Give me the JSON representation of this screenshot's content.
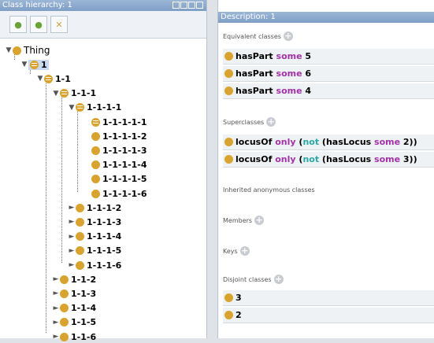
{
  "left": {
    "title": "Class hierarchy: 1",
    "tree": [
      {
        "label": "Thing",
        "level": 0,
        "toggle": "▼"
      },
      {
        "label": "1",
        "level": 1,
        "toggle": "▼",
        "selected": true,
        "eq": true
      },
      {
        "label": "1-1",
        "level": 2,
        "toggle": "▼",
        "eq": true
      },
      {
        "label": "1-1-1",
        "level": 3,
        "toggle": "▼",
        "eq": true
      },
      {
        "label": "1-1-1-1",
        "level": 4,
        "toggle": "▼",
        "eq": true
      },
      {
        "label": "1-1-1-1-1",
        "level": 5,
        "toggle": "",
        "eq": true
      },
      {
        "label": "1-1-1-1-2",
        "level": 5,
        "toggle": ""
      },
      {
        "label": "1-1-1-1-3",
        "level": 5,
        "toggle": ""
      },
      {
        "label": "1-1-1-1-4",
        "level": 5,
        "toggle": ""
      },
      {
        "label": "1-1-1-1-5",
        "level": 5,
        "toggle": ""
      },
      {
        "label": "1-1-1-1-6",
        "level": 5,
        "toggle": ""
      },
      {
        "label": "1-1-1-2",
        "level": 4,
        "toggle": "►"
      },
      {
        "label": "1-1-1-3",
        "level": 4,
        "toggle": "►"
      },
      {
        "label": "1-1-1-4",
        "level": 4,
        "toggle": "►"
      },
      {
        "label": "1-1-1-5",
        "level": 4,
        "toggle": "►"
      },
      {
        "label": "1-1-1-6",
        "level": 4,
        "toggle": "►"
      },
      {
        "label": "1-1-2",
        "level": 3,
        "toggle": "►"
      },
      {
        "label": "1-1-3",
        "level": 3,
        "toggle": "►"
      },
      {
        "label": "1-1-4",
        "level": 3,
        "toggle": "►"
      },
      {
        "label": "1-1-5",
        "level": 3,
        "toggle": "►"
      },
      {
        "label": "1-1-6",
        "level": 3,
        "toggle": "►"
      }
    ]
  },
  "right": {
    "title": "Description: 1",
    "sections": {
      "equivalent": "Equivalent classes",
      "superclasses": "Superclasses",
      "inherited": "Inherited anonymous classes",
      "members": "Members",
      "keys": "Keys",
      "disjoint": "Disjoint classes"
    },
    "equivalent_rows": [
      {
        "prop": "hasPart",
        "kw": "some",
        "val": "5"
      },
      {
        "prop": "hasPart",
        "kw": "some",
        "val": "6"
      },
      {
        "prop": "hasPart",
        "kw": "some",
        "val": "4"
      }
    ],
    "super_rows": [
      {
        "a": "locusOf",
        "only": "only",
        "p1": "(",
        "not": "not",
        "p2": " (hasLocus ",
        "some": "some",
        "v": " 2))"
      },
      {
        "a": "locusOf",
        "only": "only",
        "p1": "(",
        "not": "not",
        "p2": " (hasLocus ",
        "some": "some",
        "v": " 3))"
      }
    ],
    "disjoint_rows": [
      "3",
      "2"
    ]
  },
  "colors": {
    "class_dot": "#d8a32e",
    "keyword": "#a232a6",
    "not_keyword": "#2aa8a8"
  }
}
